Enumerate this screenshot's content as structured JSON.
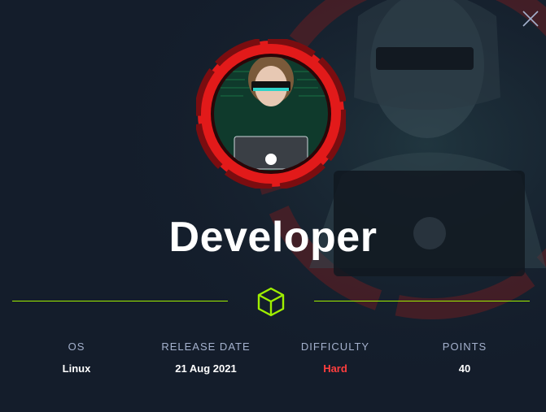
{
  "machine": {
    "name": "Developer"
  },
  "stats": [
    {
      "label": "OS",
      "value": "Linux"
    },
    {
      "label": "RELEASE DATE",
      "value": "21 Aug 2021"
    },
    {
      "label": "DIFFICULTY",
      "value": "Hard"
    },
    {
      "label": "POINTS",
      "value": "40"
    }
  ],
  "icons": {
    "close": "close-icon",
    "cube": "cube-icon"
  },
  "colors": {
    "background": "#141d2b",
    "accent": "#9fef00",
    "difficulty_hard": "#ff3e3e",
    "label": "#a4b1cd",
    "avatar_ring": "#e21a1a"
  }
}
